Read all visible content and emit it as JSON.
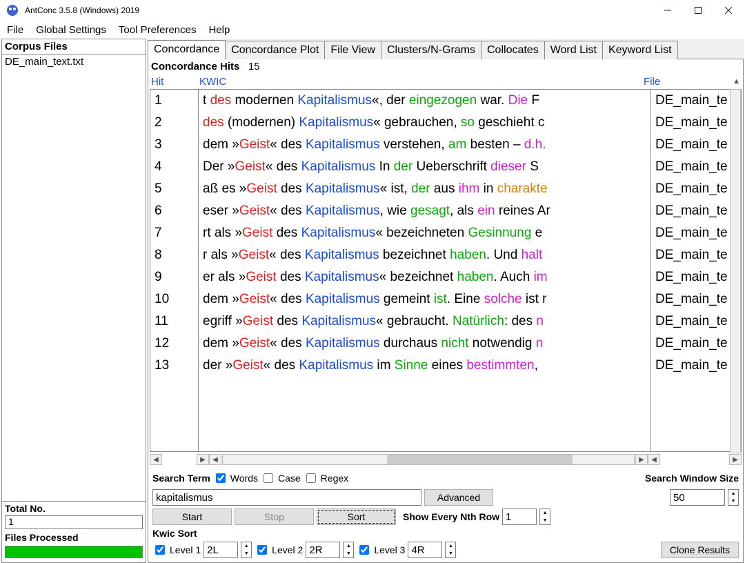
{
  "window": {
    "title": "AntConc 3.5.8 (Windows) 2019"
  },
  "menu": [
    "File",
    "Global Settings",
    "Tool Preferences",
    "Help"
  ],
  "left": {
    "head": "Corpus Files",
    "file": "DE_main_text.txt",
    "total_label": "Total No.",
    "total_value": "1",
    "processed_label": "Files Processed"
  },
  "tabs": [
    "Concordance",
    "Concordance Plot",
    "File View",
    "Clusters/N-Grams",
    "Collocates",
    "Word List",
    "Keyword List"
  ],
  "hits": {
    "label": "Concordance Hits",
    "value": "15"
  },
  "headers": {
    "hit": "Hit",
    "kwic": "KWIC",
    "file": "File"
  },
  "rows": [
    {
      "n": "1",
      "file": "DE_main_te",
      "seg": [
        [
          "",
          "t "
        ],
        [
          "red",
          "des"
        ],
        [
          "",
          " modernen "
        ],
        [
          "blue",
          "Kapitalismus"
        ],
        [
          "",
          "«, der "
        ],
        [
          "green",
          "eingezogen"
        ],
        [
          "",
          " war. "
        ],
        [
          "mag",
          "Die"
        ],
        [
          "",
          " F"
        ]
      ]
    },
    {
      "n": "2",
      "file": "DE_main_te",
      "seg": [
        [
          "red",
          "des"
        ],
        [
          "",
          " (modernen) "
        ],
        [
          "blue",
          "Kapitalismus"
        ],
        [
          "",
          "« gebrauchen, "
        ],
        [
          "green",
          "so"
        ],
        [
          "",
          " geschieht c"
        ]
      ]
    },
    {
      "n": "3",
      "file": "DE_main_te",
      "seg": [
        [
          "",
          "dem »"
        ],
        [
          "red",
          "Geist"
        ],
        [
          "",
          "« des "
        ],
        [
          "blue",
          "Kapitalismus"
        ],
        [
          "",
          " verstehen, "
        ],
        [
          "green",
          "am"
        ],
        [
          "",
          " besten – "
        ],
        [
          "mag",
          "d.h."
        ]
      ]
    },
    {
      "n": "4",
      "file": "DE_main_te",
      "seg": [
        [
          "",
          " Der »"
        ],
        [
          "red",
          "Geist"
        ],
        [
          "",
          "« des "
        ],
        [
          "blue",
          "Kapitalismus"
        ],
        [
          "",
          "  In "
        ],
        [
          "green",
          "der"
        ],
        [
          "",
          " Ueberschrift "
        ],
        [
          "mag",
          "dieser"
        ],
        [
          "",
          " S"
        ]
      ]
    },
    {
      "n": "5",
      "file": "DE_main_te",
      "seg": [
        [
          "",
          "aß es »"
        ],
        [
          "red",
          "Geist"
        ],
        [
          "",
          " des "
        ],
        [
          "blue",
          "Kapitalismus"
        ],
        [
          "",
          "« ist, "
        ],
        [
          "green",
          "der"
        ],
        [
          "",
          " aus "
        ],
        [
          "mag",
          "ihm"
        ],
        [
          "",
          " in "
        ],
        [
          "orange",
          "charakte"
        ]
      ]
    },
    {
      "n": "6",
      "file": "DE_main_te",
      "seg": [
        [
          "",
          "eser »"
        ],
        [
          "red",
          "Geist"
        ],
        [
          "",
          "« des "
        ],
        [
          "blue",
          "Kapitalismus"
        ],
        [
          "",
          ", wie "
        ],
        [
          "green",
          "gesagt"
        ],
        [
          "",
          ", als "
        ],
        [
          "mag",
          "ein"
        ],
        [
          "",
          " reines Ar"
        ]
      ]
    },
    {
      "n": "7",
      "file": "DE_main_te",
      "seg": [
        [
          "",
          "rt als »"
        ],
        [
          "red",
          "Geist"
        ],
        [
          "",
          " des "
        ],
        [
          "blue",
          "Kapitalismus"
        ],
        [
          "",
          "« bezeichneten "
        ],
        [
          "green",
          "Gesinnung"
        ],
        [
          "",
          " e"
        ]
      ]
    },
    {
      "n": "8",
      "file": "DE_main_te",
      "seg": [
        [
          "",
          "r als »"
        ],
        [
          "red",
          "Geist"
        ],
        [
          "",
          "« des "
        ],
        [
          "blue",
          "Kapitalismus"
        ],
        [
          "",
          " bezeichnet "
        ],
        [
          "green",
          "haben"
        ],
        [
          "",
          ". Und "
        ],
        [
          "mag",
          "halt"
        ]
      ]
    },
    {
      "n": "9",
      "file": "DE_main_te",
      "seg": [
        [
          "",
          "er als »"
        ],
        [
          "red",
          "Geist"
        ],
        [
          "",
          " des "
        ],
        [
          "blue",
          "Kapitalismus"
        ],
        [
          "",
          "« bezeichnet "
        ],
        [
          "green",
          "haben"
        ],
        [
          "",
          ". Auch "
        ],
        [
          "mag",
          "im"
        ]
      ]
    },
    {
      "n": "10",
      "file": "DE_main_te",
      "seg": [
        [
          "",
          "dem »"
        ],
        [
          "red",
          "Geist"
        ],
        [
          "",
          "« des "
        ],
        [
          "blue",
          "Kapitalismus"
        ],
        [
          "",
          " gemeint "
        ],
        [
          "green",
          "ist"
        ],
        [
          "",
          ". Eine "
        ],
        [
          "mag",
          "solche"
        ],
        [
          "",
          " ist r"
        ]
      ]
    },
    {
      "n": "11",
      "file": "DE_main_te",
      "seg": [
        [
          "",
          "egriff »"
        ],
        [
          "red",
          "Geist"
        ],
        [
          "",
          " des "
        ],
        [
          "blue",
          "Kapitalismus"
        ],
        [
          "",
          "« gebraucht. "
        ],
        [
          "green",
          "Natürlich"
        ],
        [
          "",
          ": des "
        ],
        [
          "mag",
          "n"
        ]
      ]
    },
    {
      "n": "12",
      "file": "DE_main_te",
      "seg": [
        [
          "",
          "dem »"
        ],
        [
          "red",
          "Geist"
        ],
        [
          "",
          "« des "
        ],
        [
          "blue",
          "Kapitalismus"
        ],
        [
          "",
          " durchaus "
        ],
        [
          "green",
          "nicht"
        ],
        [
          "",
          " notwendig "
        ],
        [
          "mag",
          "n"
        ]
      ]
    },
    {
      "n": "13",
      "file": "DE_main_te",
      "seg": [
        [
          "",
          "  der »"
        ],
        [
          "red",
          "Geist"
        ],
        [
          "",
          "« des "
        ],
        [
          "blue",
          "Kapitalismus"
        ],
        [
          "",
          " im "
        ],
        [
          "green",
          "Sinne"
        ],
        [
          "",
          " eines "
        ],
        [
          "mag",
          "bestimmten"
        ],
        [
          "",
          ", "
        ]
      ]
    }
  ],
  "search": {
    "label": "Search Term",
    "words": "Words",
    "case": "Case",
    "regex": "Regex",
    "value": "kapitalismus",
    "advanced": "Advanced",
    "start": "Start",
    "stop": "Stop",
    "sort": "Sort",
    "nth_label": "Show Every Nth Row",
    "nth_value": "1",
    "window_label": "Search Window Size",
    "window_value": "50"
  },
  "kwic_sort": {
    "label": "Kwic Sort",
    "l1": "Level 1",
    "v1": "2L",
    "l2": "Level 2",
    "v2": "2R",
    "l3": "Level 3",
    "v3": "4R",
    "clone": "Clone Results"
  }
}
